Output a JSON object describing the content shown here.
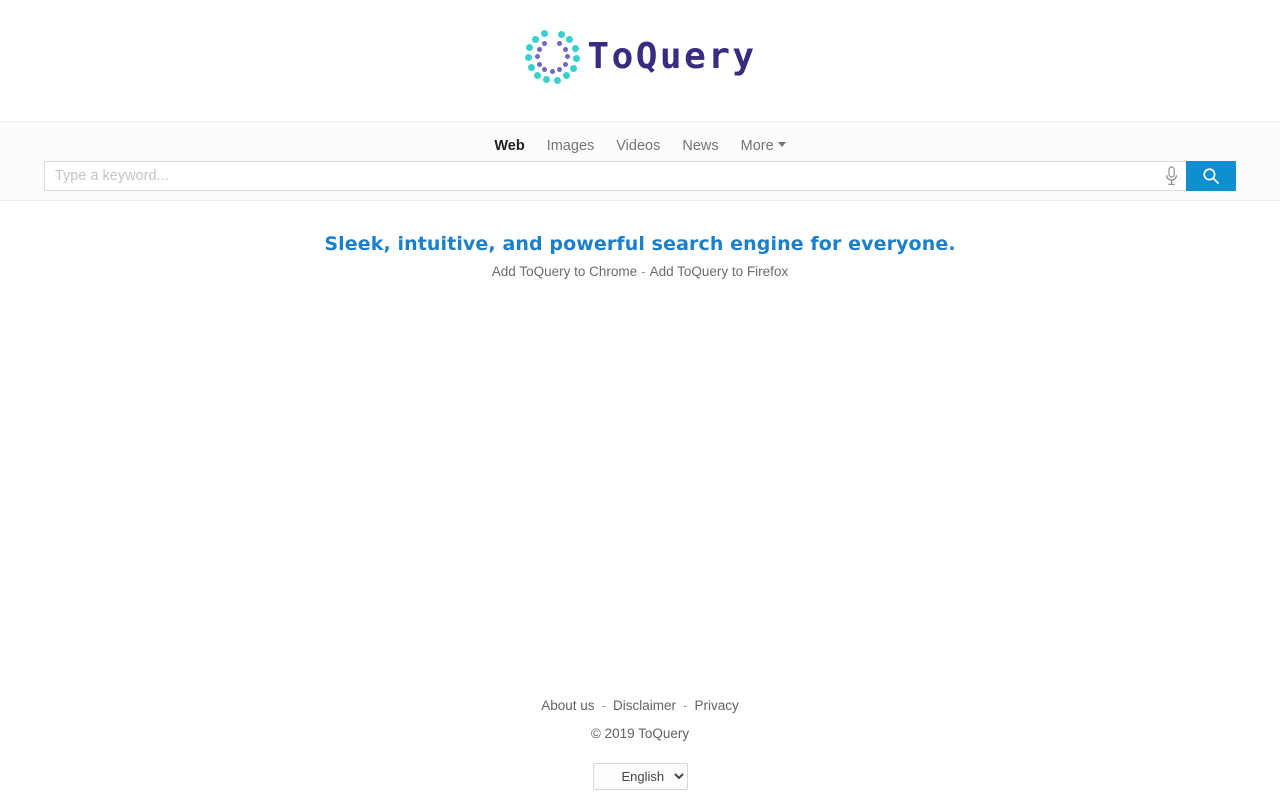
{
  "brand": {
    "name": "ToQuery",
    "logo_icon": "dot-circle-logo-icon",
    "logo_dot_outer_color": "#3ad0cf",
    "logo_dot_inner_color": "#6f67c0",
    "logo_text_color": "#382c80"
  },
  "nav": {
    "tabs": [
      {
        "label": "Web",
        "active": true
      },
      {
        "label": "Images",
        "active": false
      },
      {
        "label": "Videos",
        "active": false
      },
      {
        "label": "News",
        "active": false
      },
      {
        "label": "More",
        "active": false,
        "has_caret": true
      }
    ]
  },
  "search": {
    "value": "",
    "placeholder": "Type a keyword...",
    "mic_icon": "microphone-icon",
    "search_icon": "search-icon",
    "button_color": "#108ed2"
  },
  "main": {
    "tagline": "Sleek, intuitive, and powerful search engine for everyone.",
    "tagline_color": "#1b7fc9",
    "addons": {
      "chrome": "Add ToQuery to Chrome",
      "separator": "-",
      "firefox": "Add ToQuery to Firefox"
    }
  },
  "footer": {
    "links": [
      {
        "label": "About us"
      },
      {
        "label": "Disclaimer"
      },
      {
        "label": "Privacy"
      }
    ],
    "separator": "-",
    "copyright": "© 2019 ToQuery",
    "language": {
      "selected": "English",
      "options": [
        "English"
      ]
    }
  }
}
